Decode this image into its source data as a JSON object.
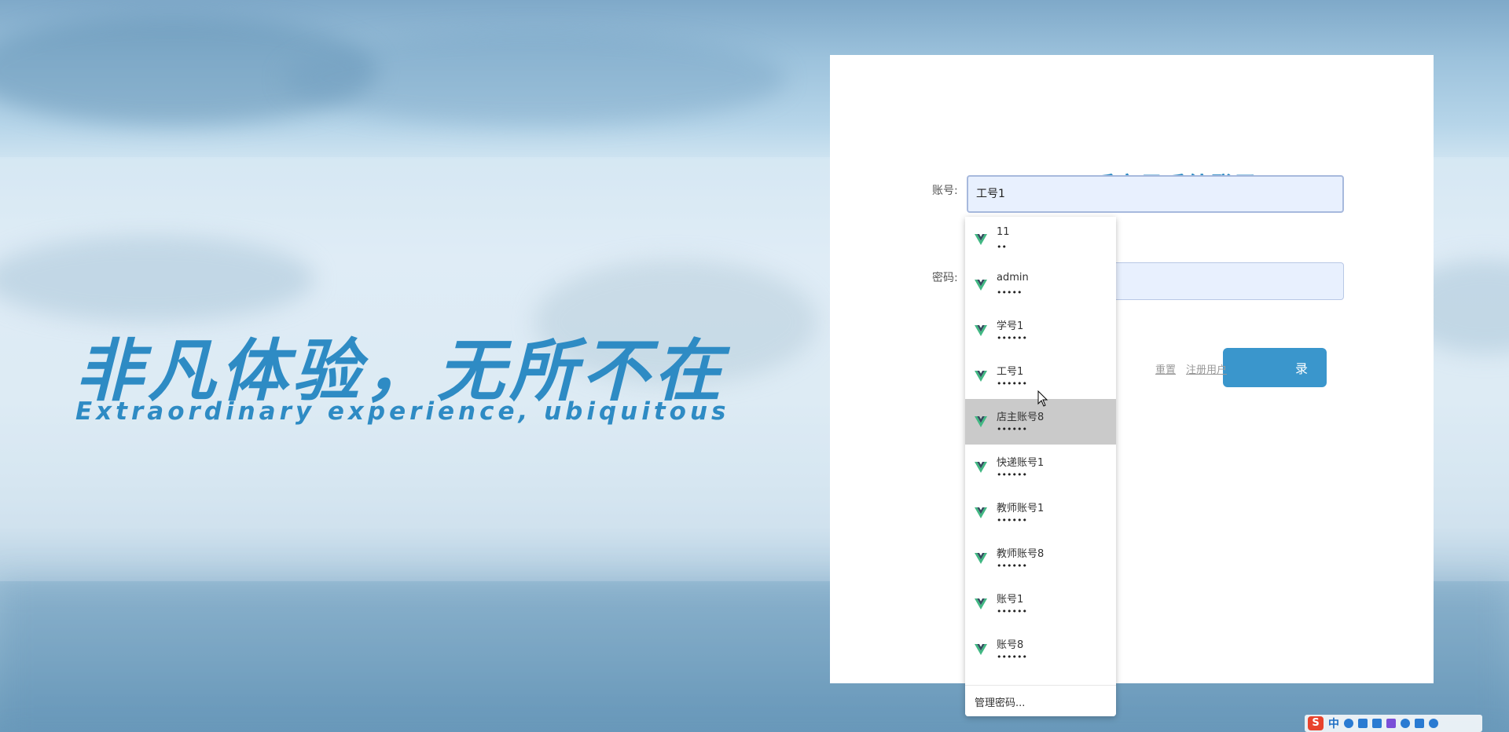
{
  "hero": {
    "title": "非凡体验，无所不在",
    "subtitle": "Extraordinary experience, ubiquitous"
  },
  "login": {
    "title": "二手交易系统登录",
    "account_label": "账号:",
    "password_label": "密码:",
    "account_value": "工号1",
    "login_button": "录",
    "reset_link": "重置",
    "register_link": "注册用户"
  },
  "autofill": {
    "items": [
      {
        "name": "11",
        "dots": "••"
      },
      {
        "name": "admin",
        "dots": "•••••"
      },
      {
        "name": "学号1",
        "dots": "••••••"
      },
      {
        "name": "工号1",
        "dots": "••••••"
      },
      {
        "name": "店主账号8",
        "dots": "••••••",
        "active": true
      },
      {
        "name": "快递账号1",
        "dots": "••••••"
      },
      {
        "name": "教师账号1",
        "dots": "••••••"
      },
      {
        "name": "教师账号8",
        "dots": "••••••"
      },
      {
        "name": "账号1",
        "dots": "••••••"
      },
      {
        "name": "账号8",
        "dots": "••••••"
      }
    ],
    "footer": "管理密码..."
  },
  "ime": {
    "logo": "S",
    "mode": "中"
  },
  "colors": {
    "accent": "#2e8bc4",
    "button": "#3a96cc",
    "input_bg": "#e8f0fe",
    "highlight": "#cacaca",
    "vue_green": "#41b883",
    "vue_dark": "#35495e"
  }
}
